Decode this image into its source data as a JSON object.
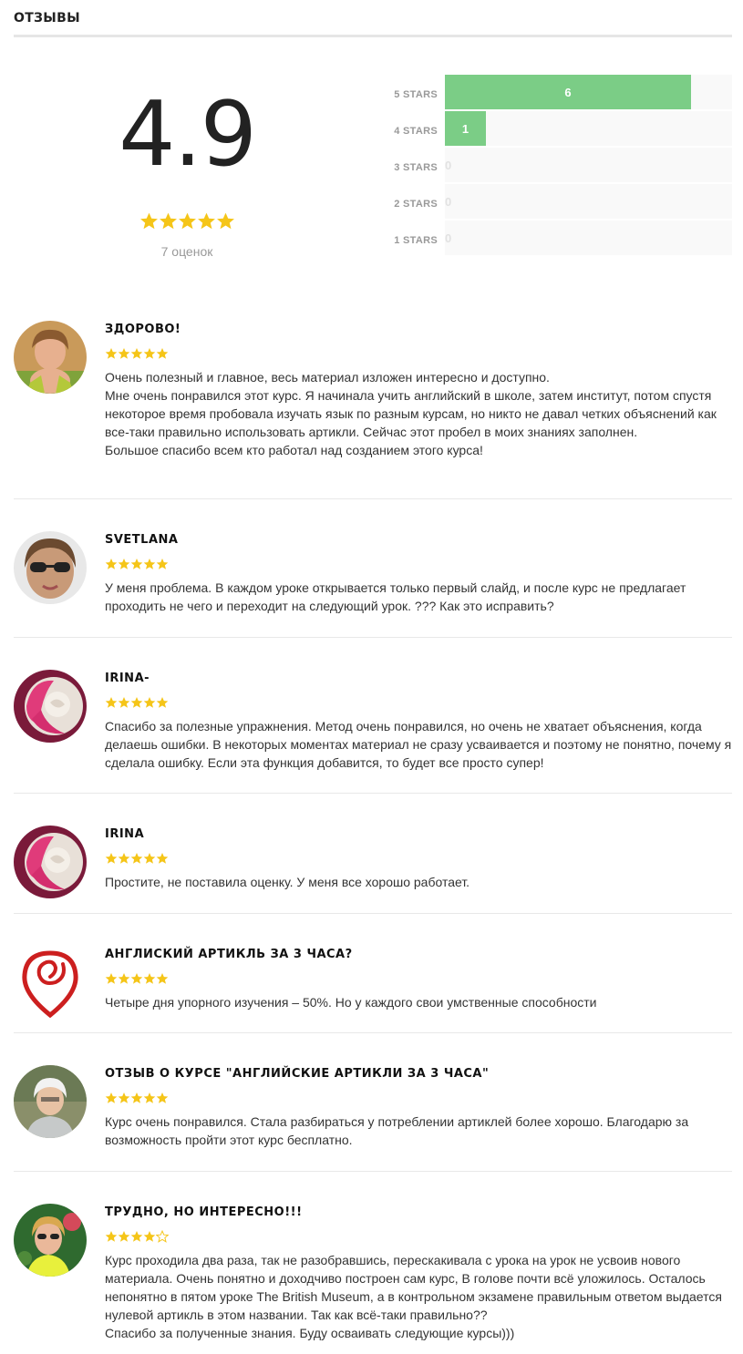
{
  "section": {
    "title": "ОТЗЫВЫ"
  },
  "summary": {
    "average": "4.9",
    "average_stars": 5,
    "count_label": "7 оценок"
  },
  "distribution": [
    {
      "label": "5 STARS",
      "count": 6,
      "fraction": 0.857
    },
    {
      "label": "4 STARS",
      "count": 1,
      "fraction": 0.143
    },
    {
      "label": "3 STARS",
      "count": 0,
      "fraction": 0
    },
    {
      "label": "2 STARS",
      "count": 0,
      "fraction": 0
    },
    {
      "label": "1 STARS",
      "count": 0,
      "fraction": 0
    }
  ],
  "colors": {
    "bar_fill": "#7bcd86",
    "bar_track": "#f9f9f9",
    "star": "#f5c518",
    "divider": "#e8e8e8"
  },
  "reviews": [
    {
      "title": "Здорово!",
      "rating": 5,
      "avatar": "photo-woman-green-top",
      "text": "Очень полезный и главное, весь материал изложен интересно и доступно.\nМне очень понравился этот курс. Я начинала учить английский в школе, затем институт, потом спустя некоторое время пробовала изучать язык по разным курсам, но никто не давал четких объяснений как все-таки правильно использовать артикли. Сейчас этот пробел в моих знаниях заполнен.\nБольшое спасибо всем кто работал над созданием этого курса!"
    },
    {
      "title": "Svetlana",
      "rating": 5,
      "avatar": "photo-woman-sunglasses",
      "text": "У меня проблема. В каждом уроке открывается только первый слайд, и после курс не предлагает проходить не чего и переходит на следующий урок. ??? Как это исправить?"
    },
    {
      "title": "Irina-",
      "rating": 5,
      "avatar": "photo-pink-rose",
      "text": "Спасибо за полезные упражнения. Метод очень понравился, но очень не хватает объяснения, когда делаешь ошибки. В некоторых моментах материал не сразу усваивается и поэтому не понятно, почему я сделала ошибку. Если эта функция добавится, то будет все просто супер!"
    },
    {
      "title": "Irina",
      "rating": 5,
      "avatar": "photo-pink-rose",
      "text": "Простите, не поставила оценку. У меня все хорошо работает."
    },
    {
      "title": "Англиский артикль за 3 часа?",
      "rating": 5,
      "avatar": "red-spiral-logo",
      "text": "Четыре дня упорного изучения – 50%. Но у каждого свои умственные способности"
    },
    {
      "title": "Отзыв о курсе \"Английские артикли за 3 часа\"",
      "rating": 5,
      "avatar": "photo-woman-white-hair",
      "text": "Курс очень понравился. Стала разбираться у потреблении артиклей более хорошо. Благодарю за возможность пройти этот курс бесплатно."
    },
    {
      "title": "Трудно, но интересно!!!",
      "rating": 4,
      "avatar": "photo-woman-garden",
      "text": "Курс проходила два раза, так не разобравшись, перескакивала с урока на урок не усвоив нового материала. Очень понятно и доходчиво построен сам курс, В голове почти всё уложилось. Осталось непонятно в пятом уроке The British Museum, а в контрольном экзамене правильным ответом выдается нулевой артикль в этом названии. Так как всё-таки правильно??\nСпасибо за полученные знания. Буду осваивать следующие курсы)))"
    }
  ]
}
